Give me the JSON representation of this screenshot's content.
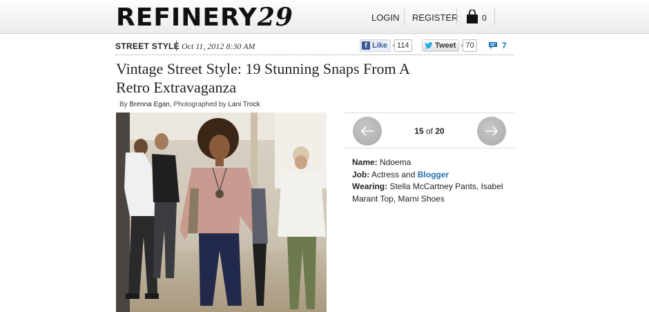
{
  "header": {
    "logo_main": "REFINERY",
    "logo_num": "29",
    "login_label": "LOGIN",
    "register_label": "REGISTER",
    "bag_count": "0"
  },
  "meta": {
    "section": "STREET STYLE",
    "date": "Oct 11, 2012 8:30 AM",
    "like_label": "Like",
    "like_count": "114",
    "tweet_label": "Tweet",
    "tweet_count": "70",
    "comment_count": "7"
  },
  "article": {
    "title": "Vintage Street Style: 19 Stunning Snaps From A Retro Extravaganza",
    "byline_by": "By ",
    "byline_author": "Brenna Egan",
    "byline_mid": ", Photographed by ",
    "byline_photographer": "Lani Trock"
  },
  "gallery": {
    "current": "15",
    "of_label": "of",
    "total": "20",
    "name_label": "Name:",
    "name_value": "Ndoema",
    "job_label": "Job:",
    "job_value": "Actress and",
    "job_link": "Blogger",
    "wearing_label": "Wearing:",
    "wearing_value": "Stella McCartney Pants, Isabel Marant Top, Marni Shoes"
  },
  "colors": {
    "link_blue": "#1f6fb0",
    "facebook_blue": "#3b5998",
    "arrow_gray": "#b3b3b3"
  }
}
